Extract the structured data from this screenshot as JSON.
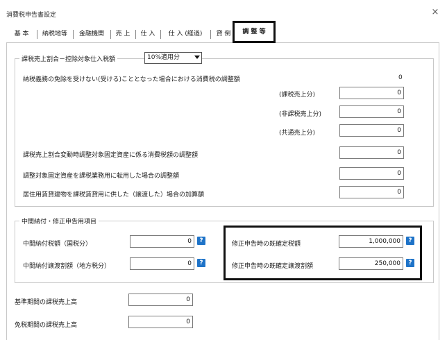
{
  "window": {
    "title": "消費税申告書設定",
    "close": "×"
  },
  "tabs": [
    "基 本",
    "納税地等",
    "金融機関",
    "売 上",
    "仕 入",
    "仕 入 (経過)",
    "貸 倒",
    "調 整 等"
  ],
  "section1": {
    "legend": "課税売上割合－控除対象仕入税額",
    "select_value": "10%適用分",
    "rows": {
      "exemption_label": "納税義務の免除を受けない(受ける)こととなった場合における消費税の調整額",
      "exemption_value": "0",
      "taxable_label": "(課税売上分)",
      "taxable_value": "0",
      "nontaxable_label": "(非課税売上分)",
      "nontaxable_value": "0",
      "common_label": "(共通売上分)",
      "common_value": "0",
      "ratio_change_label": "課税売上割合変動時調整対象固定資産に係る消費税額の調整額",
      "ratio_change_value": "0",
      "conversion_label": "調整対象固定資産を課税業務用に転用した場合の調整額",
      "conversion_value": "0",
      "residential_label": "居住用賃貸建物を課税賃貸用に供した（譲渡した）場合の加算額",
      "residential_value": "0"
    }
  },
  "section2": {
    "legend": "中間納付・修正申告用項目",
    "interim_national_label": "中間納付税額（国税分）",
    "interim_national_value": "0",
    "interim_local_label": "中間納付譲渡割額（地方税分）",
    "interim_local_value": "0",
    "amend_tax_label": "修正申告時の既確定税額",
    "amend_tax_value": "1,000,000",
    "amend_transfer_label": "修正申告時の既確定譲渡割額",
    "amend_transfer_value": "250,000",
    "help": "?"
  },
  "bottom": {
    "base_period_label": "基準期間の課税売上高",
    "base_period_value": "0",
    "exempt_period_label": "免税期間の課税売上高",
    "exempt_period_value": "0"
  }
}
